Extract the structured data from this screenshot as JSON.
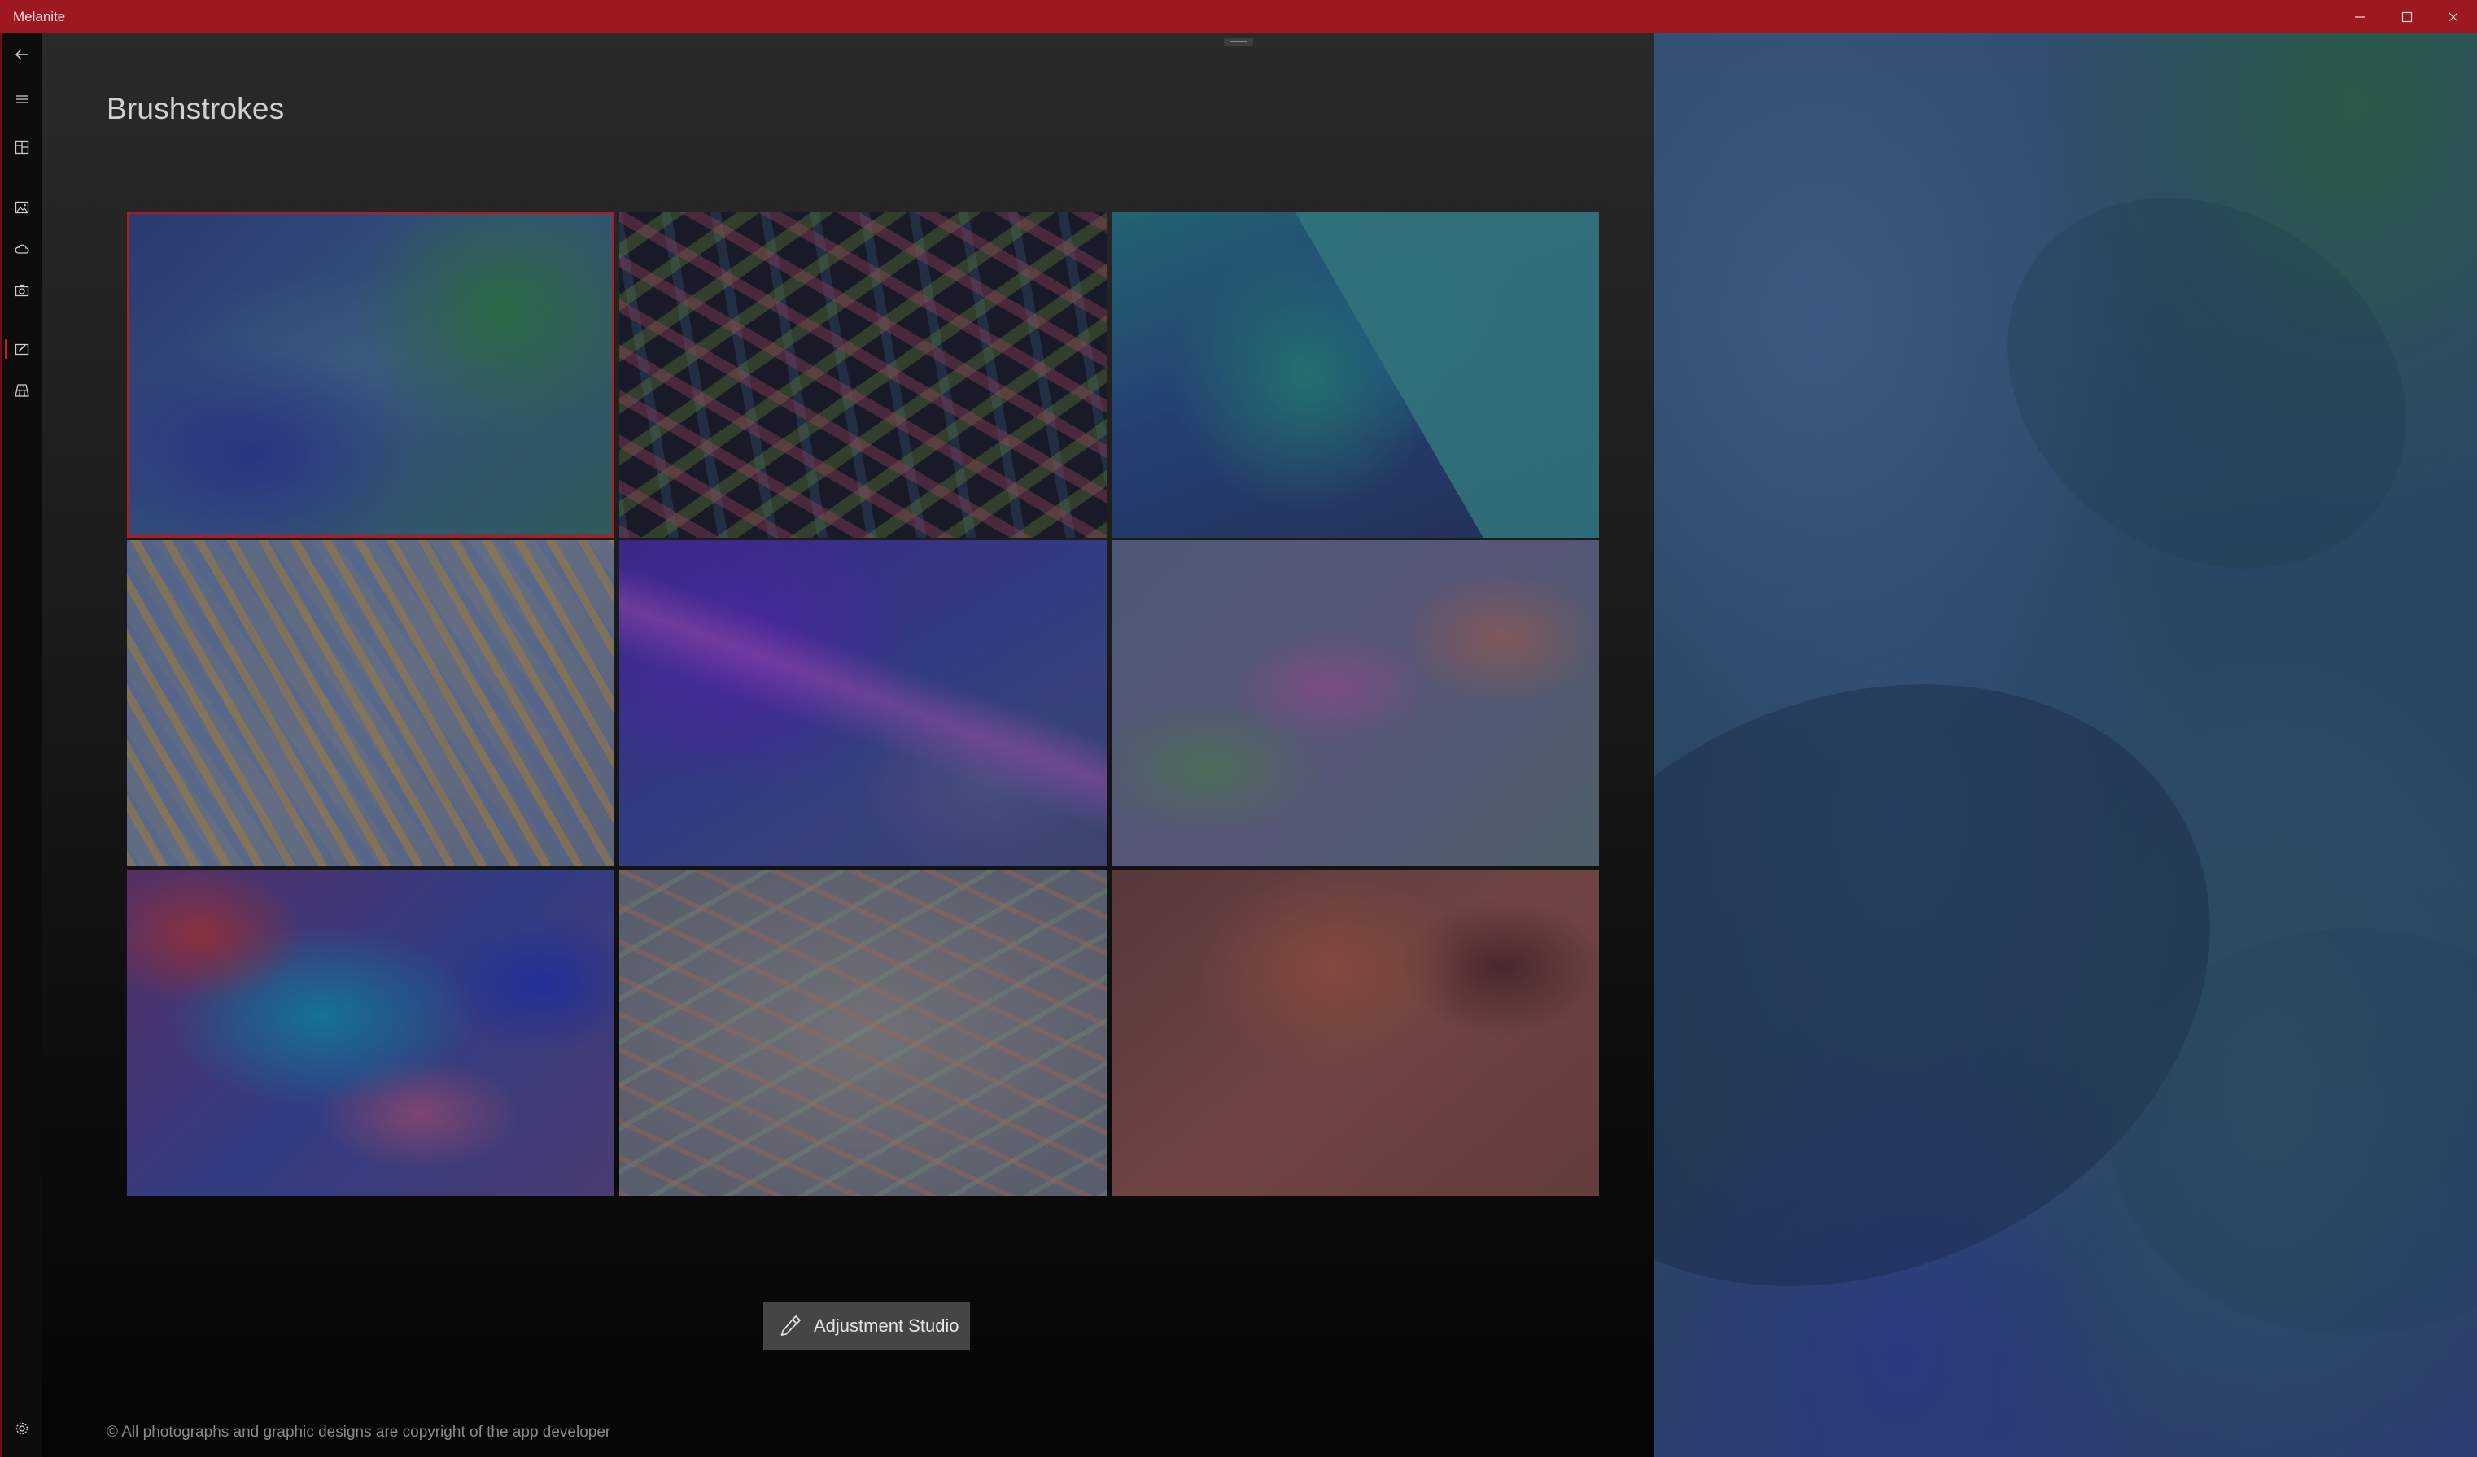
{
  "window": {
    "title": "Melanite",
    "controls": [
      "minimize",
      "maximize",
      "close"
    ]
  },
  "nav": {
    "items": [
      {
        "name": "back",
        "icon": "back-arrow-icon"
      },
      {
        "name": "menu",
        "icon": "hamburger-icon"
      },
      {
        "name": "dashboard",
        "icon": "dashboard-icon"
      },
      {
        "name": "images",
        "icon": "image-icon"
      },
      {
        "name": "cloud",
        "icon": "cloud-icon"
      },
      {
        "name": "camera",
        "icon": "camera-icon"
      },
      {
        "name": "brushstrokes",
        "icon": "paint-icon",
        "active": true
      },
      {
        "name": "perspective-grid",
        "icon": "grid-icon"
      },
      {
        "name": "settings",
        "icon": "gear-icon"
      }
    ]
  },
  "page": {
    "title": "Brushstrokes"
  },
  "gallery": {
    "selected_index": 0,
    "tile_count": 9
  },
  "actions": {
    "adjustment_studio_label": "Adjustment Studio",
    "adjustment_studio_icon": "eyedropper-icon"
  },
  "footer": {
    "copyright": "© All photographs and graphic designs are copyright of the app developer"
  },
  "colors": {
    "titlebar": "#9e1820",
    "accent": "#b01c24",
    "button": "#454545"
  }
}
